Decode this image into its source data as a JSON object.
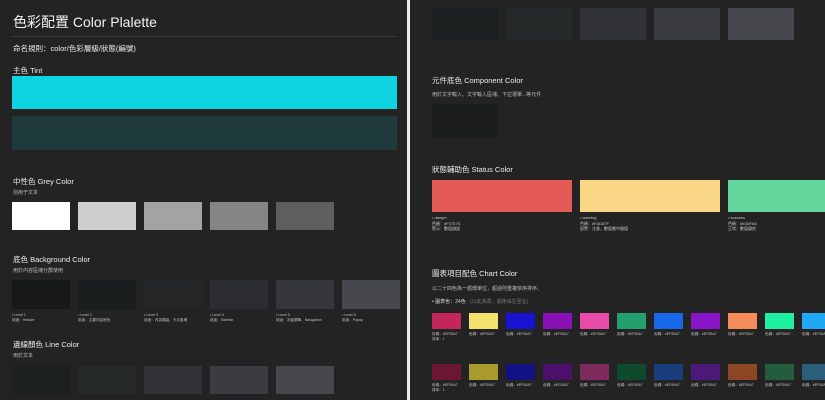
{
  "doc_title": "色彩配置 Color Plalette",
  "naming_rule": "命名規則：color/色彩層級/狀態(編號)",
  "tint": {
    "title": "主色 Tint",
    "colors": [
      "#0dd4e0",
      "#1f3a3c"
    ]
  },
  "grey": {
    "title": "中性色 Grey Color",
    "desc": "別用于文本",
    "colors": [
      "#ffffff",
      "#cfcfcf",
      "#a3a3a3",
      "#858585",
      "#5e5e5e"
    ]
  },
  "bg": {
    "title": "底色 Background Color",
    "desc": "用於內容區塊分群使用",
    "colors": [
      "#161918",
      "#1b1e1e",
      "#242628",
      "#2b2d31",
      "#35373b",
      "#46484d"
    ],
    "labels": [
      [
        "• Level 1",
        "用途：Header"
      ],
      [
        "• Level 2",
        "用途：主要內容底色"
      ],
      [
        "• Level 3",
        "用途：內容模組、卡片區塊"
      ],
      [
        "• Level 4",
        "用途：Sidebar"
      ],
      [
        "• Level 5",
        "用途：次級選單、Navigation"
      ],
      [
        "• Level 6",
        "用途：Popup"
      ]
    ]
  },
  "line": {
    "title": "邊線顏色 Line Color",
    "desc": "用於文本",
    "colors": [
      "#1d2020",
      "#26292a",
      "#303236",
      "#3a3c41",
      "#46484d"
    ]
  },
  "right_top_colors": [
    "#1d2020",
    "#26292a",
    "#303236",
    "#393b40",
    "#46484d"
  ],
  "component": {
    "title": "元件底色 Component Color",
    "desc": "用於文字輸入、文字輸入區塊、下拉選單...等元件",
    "color": "#1c1d1d"
  },
  "status": {
    "title": "狀態輔助色 Status Color",
    "items": [
      {
        "color": "#e35a57",
        "lines": [
          "• danger",
          "色碼：#F3757S",
          "警示：數值錯誤"
        ]
      },
      {
        "color": "#f9d786",
        "lines": [
          "• warning",
          "色碼：#FAD87F",
          "部警：注意，數值需中間值"
        ]
      },
      {
        "color": "#64d79f",
        "lines": [
          "• success",
          "色碼：#63DFA6",
          "正常：數值優良"
        ]
      }
    ]
  },
  "chart": {
    "title": "圖表項目配色 Chart Color",
    "desc": "以二十四色為一循環單位，超過則重複依序排序。",
    "count_label": "• 圖表色：24色",
    "count_note": "(以此為準，順序由左至右)",
    "row1": [
      "#c2265b",
      "#f3e16b",
      "#1813d0",
      "#8a11b7",
      "#e84aa9",
      "#24a06f",
      "#1767e8",
      "#8a14c7",
      "#f68b5c",
      "#1ff0a1",
      "#1ea8f5"
    ],
    "row2": [
      "#6b1633",
      "#a99b2f",
      "#121285",
      "#4b1069",
      "#7d2a5c",
      "#0e4a2e",
      "#193e7b",
      "#4b1a78",
      "#8b4623",
      "#245d3d",
      "#2a5e7b"
    ],
    "item_label": "色碼：#EF55A7",
    "row1_sub": "排序：1",
    "row2_sub": "排序：1"
  }
}
